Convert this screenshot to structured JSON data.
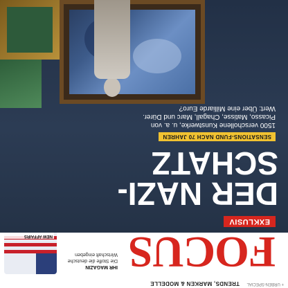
{
  "strip": {
    "text": "TRENDS, MARKEN & MODELLE",
    "prefix": "+ URBEN-SPECIAL"
  },
  "masthead": {
    "logo": "FOCUS",
    "promo_title": "IHR MAGAZIN",
    "promo_text": "Die Stoffe die deutsche Wirtschaft eingeben",
    "inset_label": "NEW AFFAIRS"
  },
  "cover": {
    "badge": "EXKLUSIV",
    "headline_line1": "DER NAZI-",
    "headline_line2": "SCHATZ",
    "kicker": "SENSATIONS-FUND NACH 70 JAHREN",
    "teaser": "1500 verschollene Kunstwerke, u. a. von Picasso, Matisse, Chagall, Marc und Dürer. Wert: Über eine Milliarde Euro?"
  },
  "colors": {
    "logo_red": "#d7261e",
    "cover_blue": "#2c3c54",
    "kicker_yellow": "#f1c231"
  }
}
